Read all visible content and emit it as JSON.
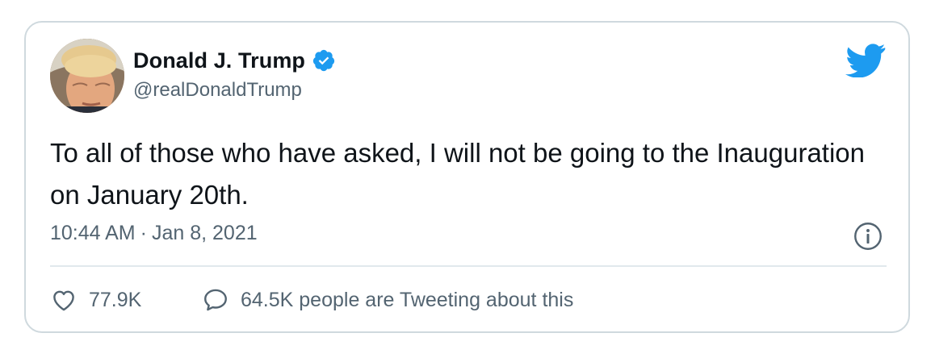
{
  "tweet": {
    "author": {
      "name": "Donald J. Trump",
      "handle": "@realDonaldTrump",
      "verified": true
    },
    "text": "To all of those who have asked, I will not be going to the Inauguration on January 20th.",
    "time": "10:44 AM",
    "separator": "·",
    "date": "Jan 8, 2021",
    "likes": "77.9K",
    "talking": "64.5K people are Tweeting about this"
  },
  "icons": {
    "brand": "twitter-bird-icon",
    "verified": "verified-badge-icon",
    "info": "info-icon",
    "like": "heart-icon",
    "reply": "speech-bubble-icon"
  },
  "colors": {
    "accent": "#1d9bf0",
    "text": "#0f1419",
    "secondary": "#536471",
    "border": "#cfd9de"
  }
}
